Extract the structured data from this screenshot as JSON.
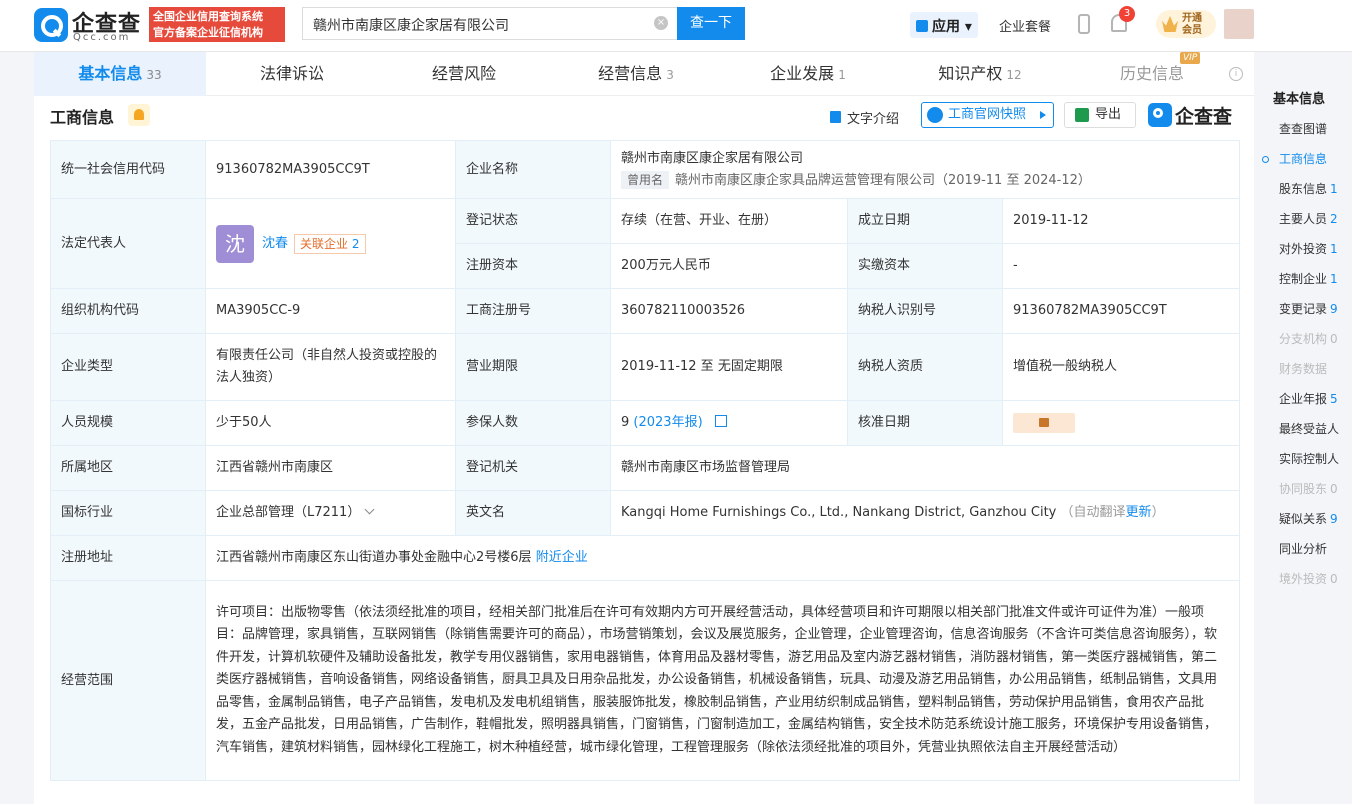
{
  "header": {
    "logo_cn": "企查查",
    "logo_en": "Qcc.com",
    "badge_line1": "全国企业信用查询系统",
    "badge_line2": "官方备案企业征信机构",
    "search_value": "赣州市南康区康企家居有限公司",
    "search_button": "查一下",
    "apps_label": "应用",
    "suite_label": "企业套餐",
    "notif_count": "3",
    "vip_line1": "开通",
    "vip_line2": "会员"
  },
  "tabs": [
    {
      "label": "基本信息",
      "count": "33"
    },
    {
      "label": "法律诉讼",
      "count": ""
    },
    {
      "label": "经营风险",
      "count": ""
    },
    {
      "label": "经营信息",
      "count": "3"
    },
    {
      "label": "企业发展",
      "count": "1"
    },
    {
      "label": "知识产权",
      "count": "12"
    },
    {
      "label": "历史信息",
      "count": "",
      "vip": "VIP"
    }
  ],
  "section": {
    "title": "工商信息",
    "tool_text": "文字介绍",
    "snapshot": "工商官网快照",
    "export": "导出",
    "brand": "企查查"
  },
  "info": {
    "credit_code_label": "统一社会信用代码",
    "credit_code": "91360782MA3905CC9T",
    "name_label": "企业名称",
    "name": "赣州市南康区康企家居有限公司",
    "former_tag": "曾用名",
    "former_name": "赣州市南康区康企家具品牌运营管理有限公司（2019-11 至 2024-12）",
    "legal_label": "法定代表人",
    "legal_avatar": "沈",
    "legal_name": "沈春",
    "related_label": "关联企业",
    "related_count": "2",
    "status_label": "登记状态",
    "status": "存续（在营、开业、在册）",
    "founded_label": "成立日期",
    "founded": "2019-11-12",
    "capital_label": "注册资本",
    "capital": "200万元人民币",
    "paid_label": "实缴资本",
    "paid": "-",
    "org_code_label": "组织机构代码",
    "org_code": "MA3905CC-9",
    "reg_no_label": "工商注册号",
    "reg_no": "360782110003526",
    "taxpayer_id_label": "纳税人识别号",
    "taxpayer_id": "91360782MA3905CC9T",
    "type_label": "企业类型",
    "type": "有限责任公司（非自然人投资或控股的法人独资）",
    "term_label": "营业期限",
    "term": "2019-11-12 至 无固定期限",
    "tax_qual_label": "纳税人资质",
    "tax_qual": "增值税一般纳税人",
    "staff_label": "人员规模",
    "staff": "少于50人",
    "insured_label": "参保人数",
    "insured": "9",
    "insured_year": "(2023年报)",
    "approve_label": "核准日期",
    "region_label": "所属地区",
    "region": "江西省赣州市南康区",
    "authority_label": "登记机关",
    "authority": "赣州市南康区市场监督管理局",
    "industry_label": "国标行业",
    "industry": "企业总部管理（L7211）",
    "english_label": "英文名",
    "english": "Kangqi Home Furnishings Co., Ltd., Nankang District, Ganzhou City",
    "auto_translate": "（自动翻译",
    "update": "更新",
    "close_paren": "）",
    "address_label": "注册地址",
    "address": "江西省赣州市南康区东山街道办事处金融中心2号楼6层",
    "nearby": "附近企业",
    "scope_label": "经营范围",
    "scope": "许可项目：出版物零售（依法须经批准的项目，经相关部门批准后在许可有效期内方可开展经营活动，具体经营项目和许可期限以相关部门批准文件或许可证件为准）一般项目：品牌管理，家具销售，互联网销售（除销售需要许可的商品），市场营销策划，会议及展览服务，企业管理，企业管理咨询，信息咨询服务（不含许可类信息咨询服务），软件开发，计算机软硬件及辅助设备批发，教学专用仪器销售，家用电器销售，体育用品及器材零售，游艺用品及室内游艺器材销售，消防器材销售，第一类医疗器械销售，第二类医疗器械销售，音响设备销售，网络设备销售，厨具卫具及日用杂品批发，办公设备销售，机械设备销售，玩具、动漫及游艺用品销售，办公用品销售，纸制品销售，文具用品零售，金属制品销售，电子产品销售，发电机及发电机组销售，服装服饰批发，橡胶制品销售，产业用纺织制成品销售，塑料制品销售，劳动保护用品销售，食用农产品批发，五金产品批发，日用品销售，广告制作，鞋帽批发，照明器具销售，门窗销售，门窗制造加工，金属结构销售，安全技术防范系统设计施工服务，环境保护专用设备销售，汽车销售，建筑材料销售，园林绿化工程施工，树木种植经营，城市绿化管理，工程管理服务（除依法须经批准的项目外，凭营业执照依法自主开展经营活动）"
  },
  "sidenav": {
    "head": "基本信息",
    "items": [
      {
        "label": "查查图谱",
        "count": "",
        "state": ""
      },
      {
        "label": "工商信息",
        "count": "",
        "state": "active"
      },
      {
        "label": "股东信息",
        "count": "1",
        "state": ""
      },
      {
        "label": "主要人员",
        "count": "2",
        "state": ""
      },
      {
        "label": "对外投资",
        "count": "1",
        "state": ""
      },
      {
        "label": "控制企业",
        "count": "1",
        "state": ""
      },
      {
        "label": "变更记录",
        "count": "9",
        "state": ""
      },
      {
        "label": "分支机构",
        "count": "0",
        "state": "dis"
      },
      {
        "label": "财务数据",
        "count": "",
        "state": "dis"
      },
      {
        "label": "企业年报",
        "count": "5",
        "state": ""
      },
      {
        "label": "最终受益人",
        "count": "",
        "state": ""
      },
      {
        "label": "实际控制人",
        "count": "",
        "state": ""
      },
      {
        "label": "协同股东",
        "count": "0",
        "state": "dis"
      },
      {
        "label": "疑似关系",
        "count": "9",
        "state": ""
      },
      {
        "label": "同业分析",
        "count": "",
        "state": ""
      },
      {
        "label": "境外投资",
        "count": "0",
        "state": "dis"
      }
    ]
  },
  "colors": {
    "accent": "#128bed",
    "label_bg": "#f2f9fc",
    "badge_red": "#e64a3b"
  }
}
